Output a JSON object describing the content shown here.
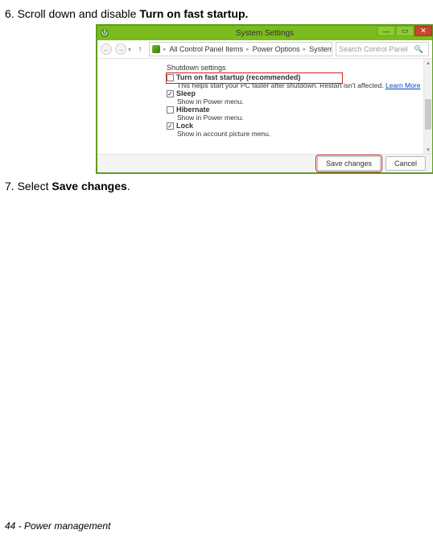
{
  "step6": {
    "prefix": "6. Scroll down and disable ",
    "bold": "Turn on fast startup."
  },
  "step7": {
    "prefix": "7. Select ",
    "bold": "Save changes",
    "suffix": "."
  },
  "footer": "44 - Power management",
  "win": {
    "title": "System Settings",
    "controls": {
      "min": "—",
      "max": "▭",
      "close": "✕"
    }
  },
  "toolbar": {
    "back": "←",
    "forward": "→",
    "up": "↑",
    "crumbs": [
      "All Control Panel Items",
      "Power Options",
      "System Settings"
    ],
    "refresh": "↻",
    "search_placeholder": "Search Control Panel",
    "search_icon": "🔍"
  },
  "settings": {
    "section": "Shutdown settings",
    "fast_startup": {
      "label": "Turn on fast startup (recommended)",
      "checked": false,
      "desc_prefix": "This helps start your PC faster after shutdown. Restart isn't affected. ",
      "learn_more": "Learn More"
    },
    "sleep": {
      "label": "Sleep",
      "checked": true,
      "desc": "Show in Power menu."
    },
    "hibernate": {
      "label": "Hibernate",
      "checked": false,
      "desc": "Show in Power menu."
    },
    "lock": {
      "label": "Lock",
      "checked": true,
      "desc": "Show in account picture menu."
    }
  },
  "buttons": {
    "save": "Save changes",
    "cancel": "Cancel"
  },
  "scroll": {
    "up": "▴",
    "down": "▾"
  }
}
